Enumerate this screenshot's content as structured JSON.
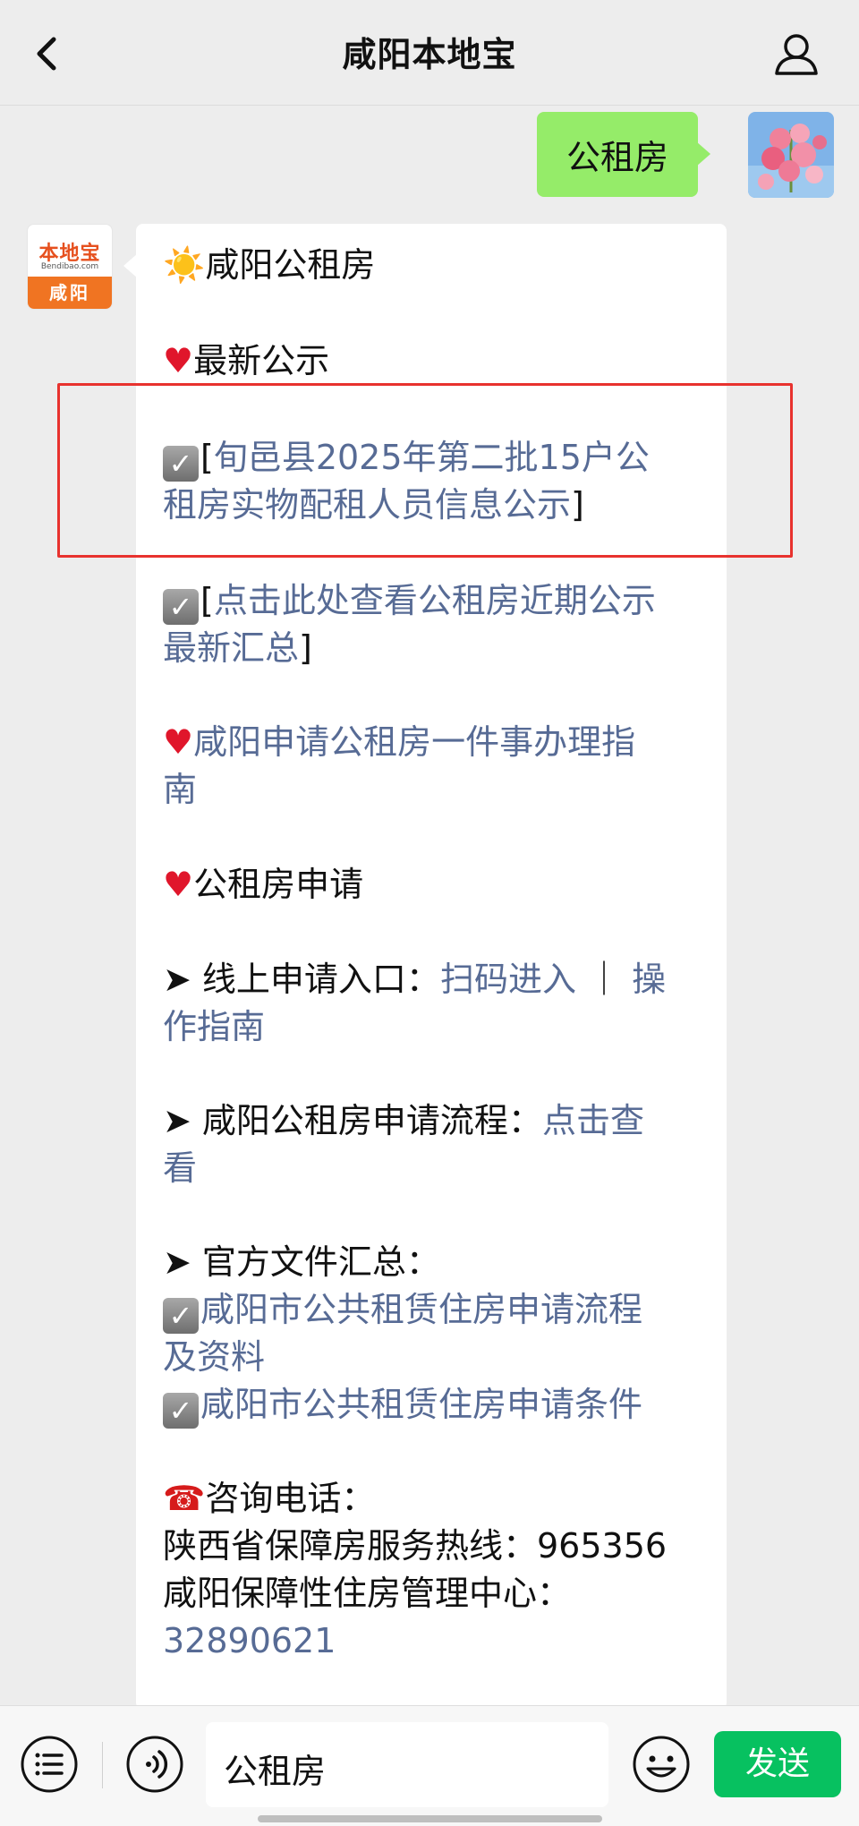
{
  "nav": {
    "title": "咸阳本地宝"
  },
  "sent": {
    "text": "公租房"
  },
  "bot_avatar": {
    "brand": "本地宝",
    "domain": "Bendibao.com",
    "city": "咸阳"
  },
  "reply": {
    "title_emoji": "☀️",
    "title": "咸阳公租房",
    "notice_heading": "最新公示",
    "notice_1_open": "[",
    "notice_1_link_a": "旬邑县2025年第二批15户公",
    "notice_1_link_b": "租房实物配租人员信息公示",
    "notice_1_close": "]",
    "notice_2_open": "[",
    "notice_2_link_a": "点击此处查看公租房近期公示",
    "notice_2_link_b": "最新汇总",
    "notice_2_close": "]",
    "guide_link_a": "咸阳申请公租房一件事办理指",
    "guide_link_b": "南",
    "apply_heading": "公租房申请",
    "arrow": "➤",
    "online_label": " 线上申请入口：",
    "online_link_scan": "扫码进入",
    "online_sep": " ｜ ",
    "online_link_guide_a": "操",
    "online_link_guide_b": "作指南",
    "process_label": " 咸阳公租房申请流程：",
    "process_link_a": "点击查",
    "process_link_b": "看",
    "docs_label": " 官方文件汇总：",
    "doc_1_a": "咸阳市公共租赁住房申请流程",
    "doc_1_b": "及资料",
    "doc_2": "咸阳市公共租赁住房申请条件",
    "phone_label": "咨询电话：",
    "hotline": "陕西省保障房服务热线：965356",
    "center_label": "咸阳保障性住房管理中心：",
    "center_phone": "32890621"
  },
  "input": {
    "value": "公租房"
  },
  "send_label": "发送",
  "colors": {
    "link": "#576b95",
    "send": "#07c160",
    "sent_bubble": "#95ec69",
    "highlight": "#e8322e"
  }
}
